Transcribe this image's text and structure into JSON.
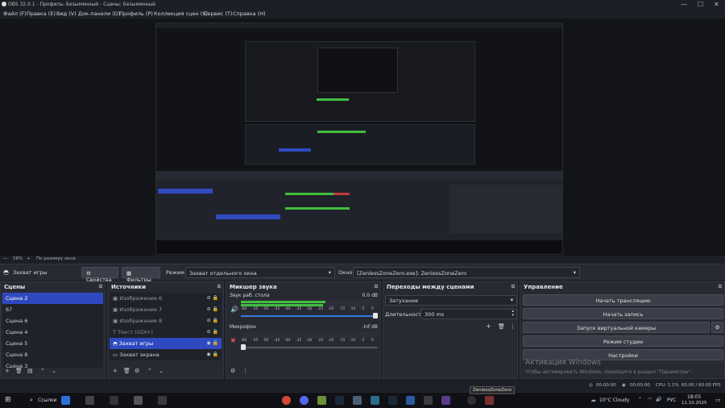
{
  "window": {
    "title": "OBS 32.0.1 - Профиль: Безымянный - Сцены: Безымянный"
  },
  "menu": [
    "Файл (F)",
    "Правка (E)",
    "Вид (V)",
    "Док-панели (D)",
    "Профиль (P)",
    "Коллекция сцен (S)",
    "Сервис (T)",
    "Справка (H)"
  ],
  "zoom": {
    "percent": "56%",
    "fit": "По размеру окна"
  },
  "source_toolbar": {
    "source_name": "Захват игры",
    "properties": "Свойства",
    "filters": "Фильтры",
    "mode_label": "Режим",
    "mode_value": "Захват отдельного окна",
    "window_label": "Окно",
    "window_value": "[ZenlessZoneZero.exe]: ZenlessZoneZero"
  },
  "scenes": {
    "title": "Сцены",
    "items": [
      "Сцена 2",
      "67",
      "Сцена 6",
      "Сцена 4",
      "Сцена 5",
      "Сцена 8",
      "Сцена 3"
    ],
    "selected": 0
  },
  "sources": {
    "title": "Источники",
    "items": [
      "Изображение 6",
      "Изображение 7",
      "Изображение 8",
      "Текст (GDI+)",
      "Захват игры",
      "Захват экрана"
    ],
    "selected": 4
  },
  "mixer": {
    "title": "Микшер звука",
    "channels": [
      {
        "name": "Звук раб. стола",
        "db": "0.0 dB",
        "level": 0.62,
        "fader": 1.0
      },
      {
        "name": "Микрофон",
        "db": "-inf dB",
        "level": 0.0,
        "fader": 0.0
      }
    ],
    "ticks": [
      "-60",
      "-55",
      "-50",
      "-45",
      "-40",
      "-35",
      "-30",
      "-25",
      "-20",
      "-15",
      "-10",
      "-5",
      "0"
    ]
  },
  "transitions": {
    "title": "Переходы между сценами",
    "type": "Затухание",
    "duration_label": "Длительность",
    "duration_value": "300 ms"
  },
  "controls": {
    "title": "Управление",
    "buttons": [
      "Начать трансляцию",
      "Начать запись",
      "Запуск виртуальной камеры",
      "Режим студии",
      "Настройки"
    ]
  },
  "watermark": {
    "line1": "Активация Windows",
    "line2": "Чтобы активировать Windows, перейдите в раздел \"Параметры\"."
  },
  "status": {
    "time1": "00:00:00",
    "time2": "00:00:00",
    "cpu": "CPU: 1.1%",
    "fps": "60.00 / 60.00 FPS"
  },
  "taskbar": {
    "search": "Ссылки",
    "tooltip": "ZenlessZoneZero",
    "weather": "10°C  Cloudy",
    "lang": "РУС",
    "clock_time": "18:05",
    "clock_date": "11.10.2025"
  },
  "colors": {
    "accent": "#2f4ac0",
    "panel": "#272a33",
    "bg": "#1d1f26",
    "meter_green": "#3fbf3f",
    "meter_yellow": "#c6c62e",
    "meter_red": "#c23a3a"
  }
}
